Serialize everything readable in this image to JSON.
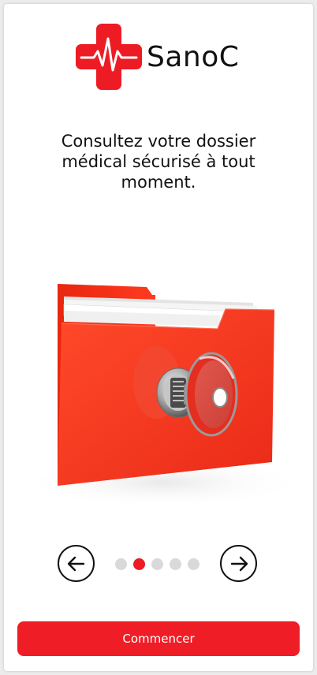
{
  "app": {
    "name": "SanoC"
  },
  "onboarding": {
    "headline": "Consultez votre dossier médical sécurisé à tout moment.",
    "illustration": "red-folder-with-key",
    "pagination": {
      "total": 5,
      "current": 2
    },
    "prev_icon": "arrow-left-icon",
    "next_icon": "arrow-right-icon"
  },
  "cta": {
    "label": "Commencer"
  },
  "colors": {
    "brand": "#ed1c24",
    "text": "#111111",
    "dot_inactive": "#d9d9d9",
    "background": "#ffffff"
  }
}
